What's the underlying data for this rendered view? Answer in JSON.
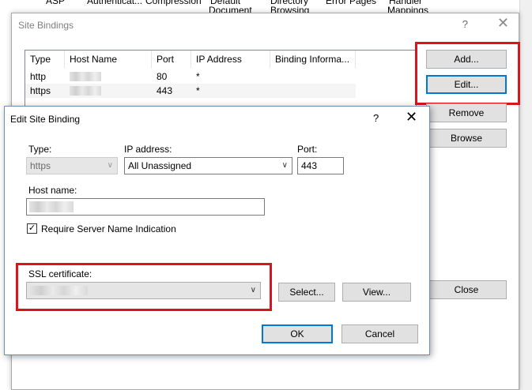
{
  "background": {
    "feature_labels": [
      "ASP",
      "Authenticat...",
      "Compression",
      "Default",
      "Directory",
      "Error Pages",
      "Handler"
    ],
    "feature_labels_line2": [
      "Document",
      "Browsing",
      "Mappings"
    ]
  },
  "site_bindings": {
    "title": "Site Bindings",
    "help_glyph": "?",
    "close_glyph": "✕",
    "columns": [
      "Type",
      "Host Name",
      "Port",
      "IP Address",
      "Binding Informa..."
    ],
    "rows": [
      {
        "type": "http",
        "port": "80",
        "ip": "*"
      },
      {
        "type": "https",
        "port": "443",
        "ip": "*"
      }
    ],
    "buttons": {
      "add": "Add...",
      "edit": "Edit...",
      "remove": "Remove",
      "browse": "Browse",
      "close": "Close"
    }
  },
  "edit_binding": {
    "title": "Edit Site Binding",
    "help_glyph": "?",
    "close_glyph": "✕",
    "type_label": "Type:",
    "type_value": "https",
    "ip_label": "IP address:",
    "ip_value": "All Unassigned",
    "port_label": "Port:",
    "port_value": "443",
    "host_label": "Host name:",
    "sni_label": "Require Server Name Indication",
    "sni_checked": true,
    "check_glyph": "✓",
    "ssl_label": "SSL certificate:",
    "select_button": "Select...",
    "view_button": "View...",
    "ok_button": "OK",
    "cancel_button": "Cancel"
  },
  "colors": {
    "highlight": "#d9141e",
    "focus": "#0078d7"
  }
}
